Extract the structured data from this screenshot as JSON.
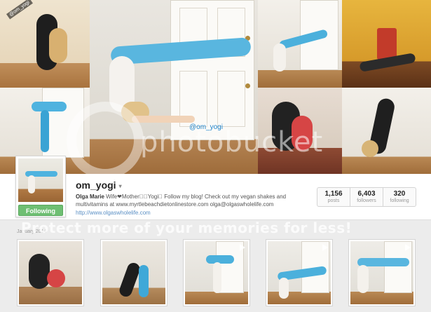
{
  "cover": {
    "tag_text": "@om_yogi",
    "corner_text": "@om_yogi"
  },
  "watermark": {
    "top": "photobucket",
    "bottom": "Protect more of your memories for less!"
  },
  "profile": {
    "username": "om_yogi",
    "caret": "▾",
    "bio_name": "Olga Marie",
    "bio_text": " Wife❤Mother󾌧󾌧Yogi󾓤 Follow my blog! Check out my vegan shakes and multivitamins at www.myrtlebeachdietonlinestore.com olga@olgaswholelife.com",
    "website": "http://www.olgaswholelife.com",
    "follow_label": "Following"
  },
  "stats": [
    {
      "value": "1,156",
      "label": "posts"
    },
    {
      "value": "6,403",
      "label": "followers"
    },
    {
      "value": "320",
      "label": "following"
    }
  ],
  "feed": {
    "date_label": "January 2014",
    "thumbs": [
      {
        "name": "partner-pose",
        "video": false
      },
      {
        "name": "handstand-floor",
        "video": false
      },
      {
        "name": "handstand-door",
        "video": true
      },
      {
        "name": "scorpion-door",
        "video": true
      },
      {
        "name": "backbend-door",
        "video": true
      }
    ]
  },
  "colors": {
    "follow_green": "#6fbf73",
    "link_blue": "#5a8fc4",
    "tag_blue": "#1e83c9"
  }
}
